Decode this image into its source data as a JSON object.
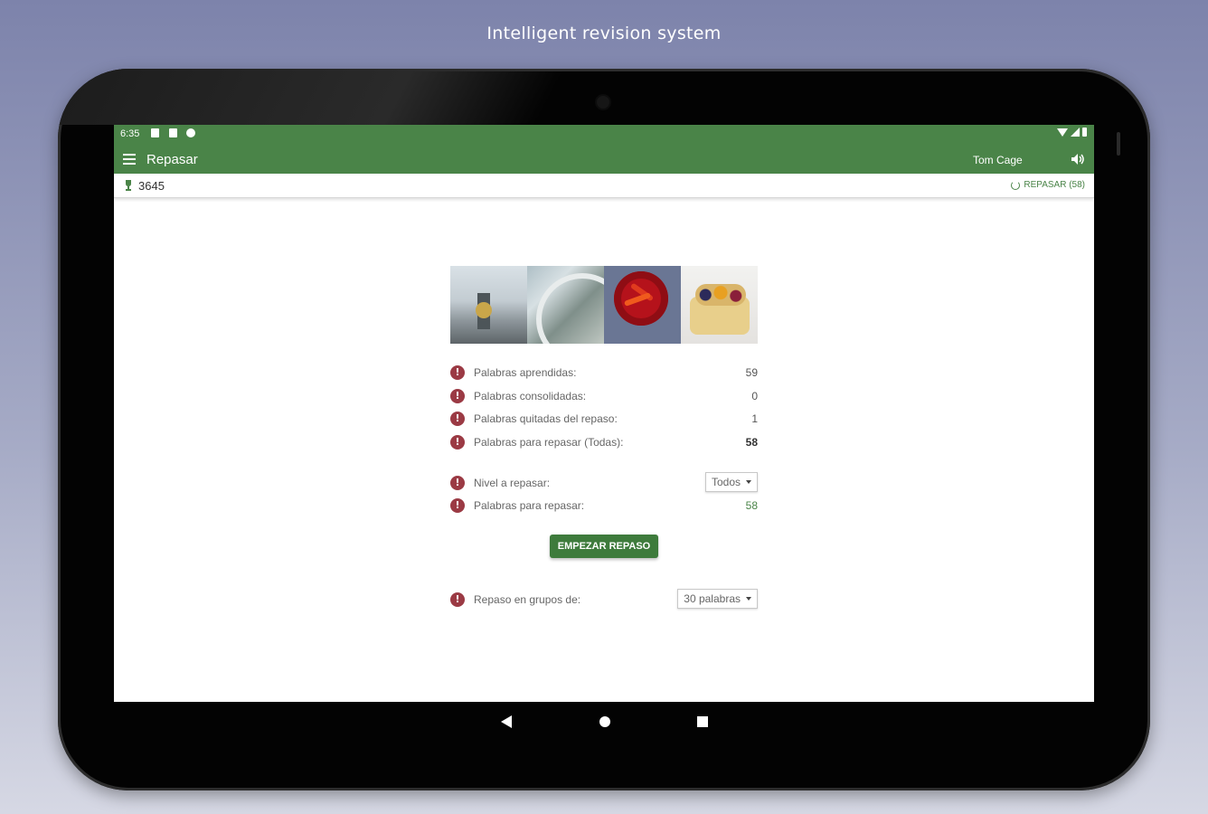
{
  "caption": "Intelligent revision system",
  "statusbar": {
    "time": "6:35"
  },
  "toolbar": {
    "title": "Repasar",
    "user": "Tom Cage"
  },
  "subbar": {
    "score": "3645",
    "repasar_label": "REPASAR (58)"
  },
  "stats": [
    {
      "label": "Palabras aprendidas:",
      "value": "59"
    },
    {
      "label": "Palabras consolidadas:",
      "value": "0"
    },
    {
      "label": "Palabras quitadas del repaso:",
      "value": "1"
    },
    {
      "label": "Palabras para repasar (Todas):",
      "value": "58"
    }
  ],
  "level": {
    "label": "Nivel a repasar:",
    "selected": "Todos"
  },
  "to_review": {
    "label": "Palabras para repasar:",
    "value": "58"
  },
  "start_button": "EMPEZAR REPASO",
  "groups": {
    "label": "Repaso en grupos de:",
    "selected": "30 palabras"
  },
  "colors": {
    "brand": "#4a8448",
    "info": "#9b3a44"
  },
  "icons": [
    "menu-icon",
    "speaker-icon",
    "trophy-icon",
    "refresh-icon",
    "info-icon",
    "back-icon",
    "home-icon",
    "recent-apps-icon"
  ]
}
